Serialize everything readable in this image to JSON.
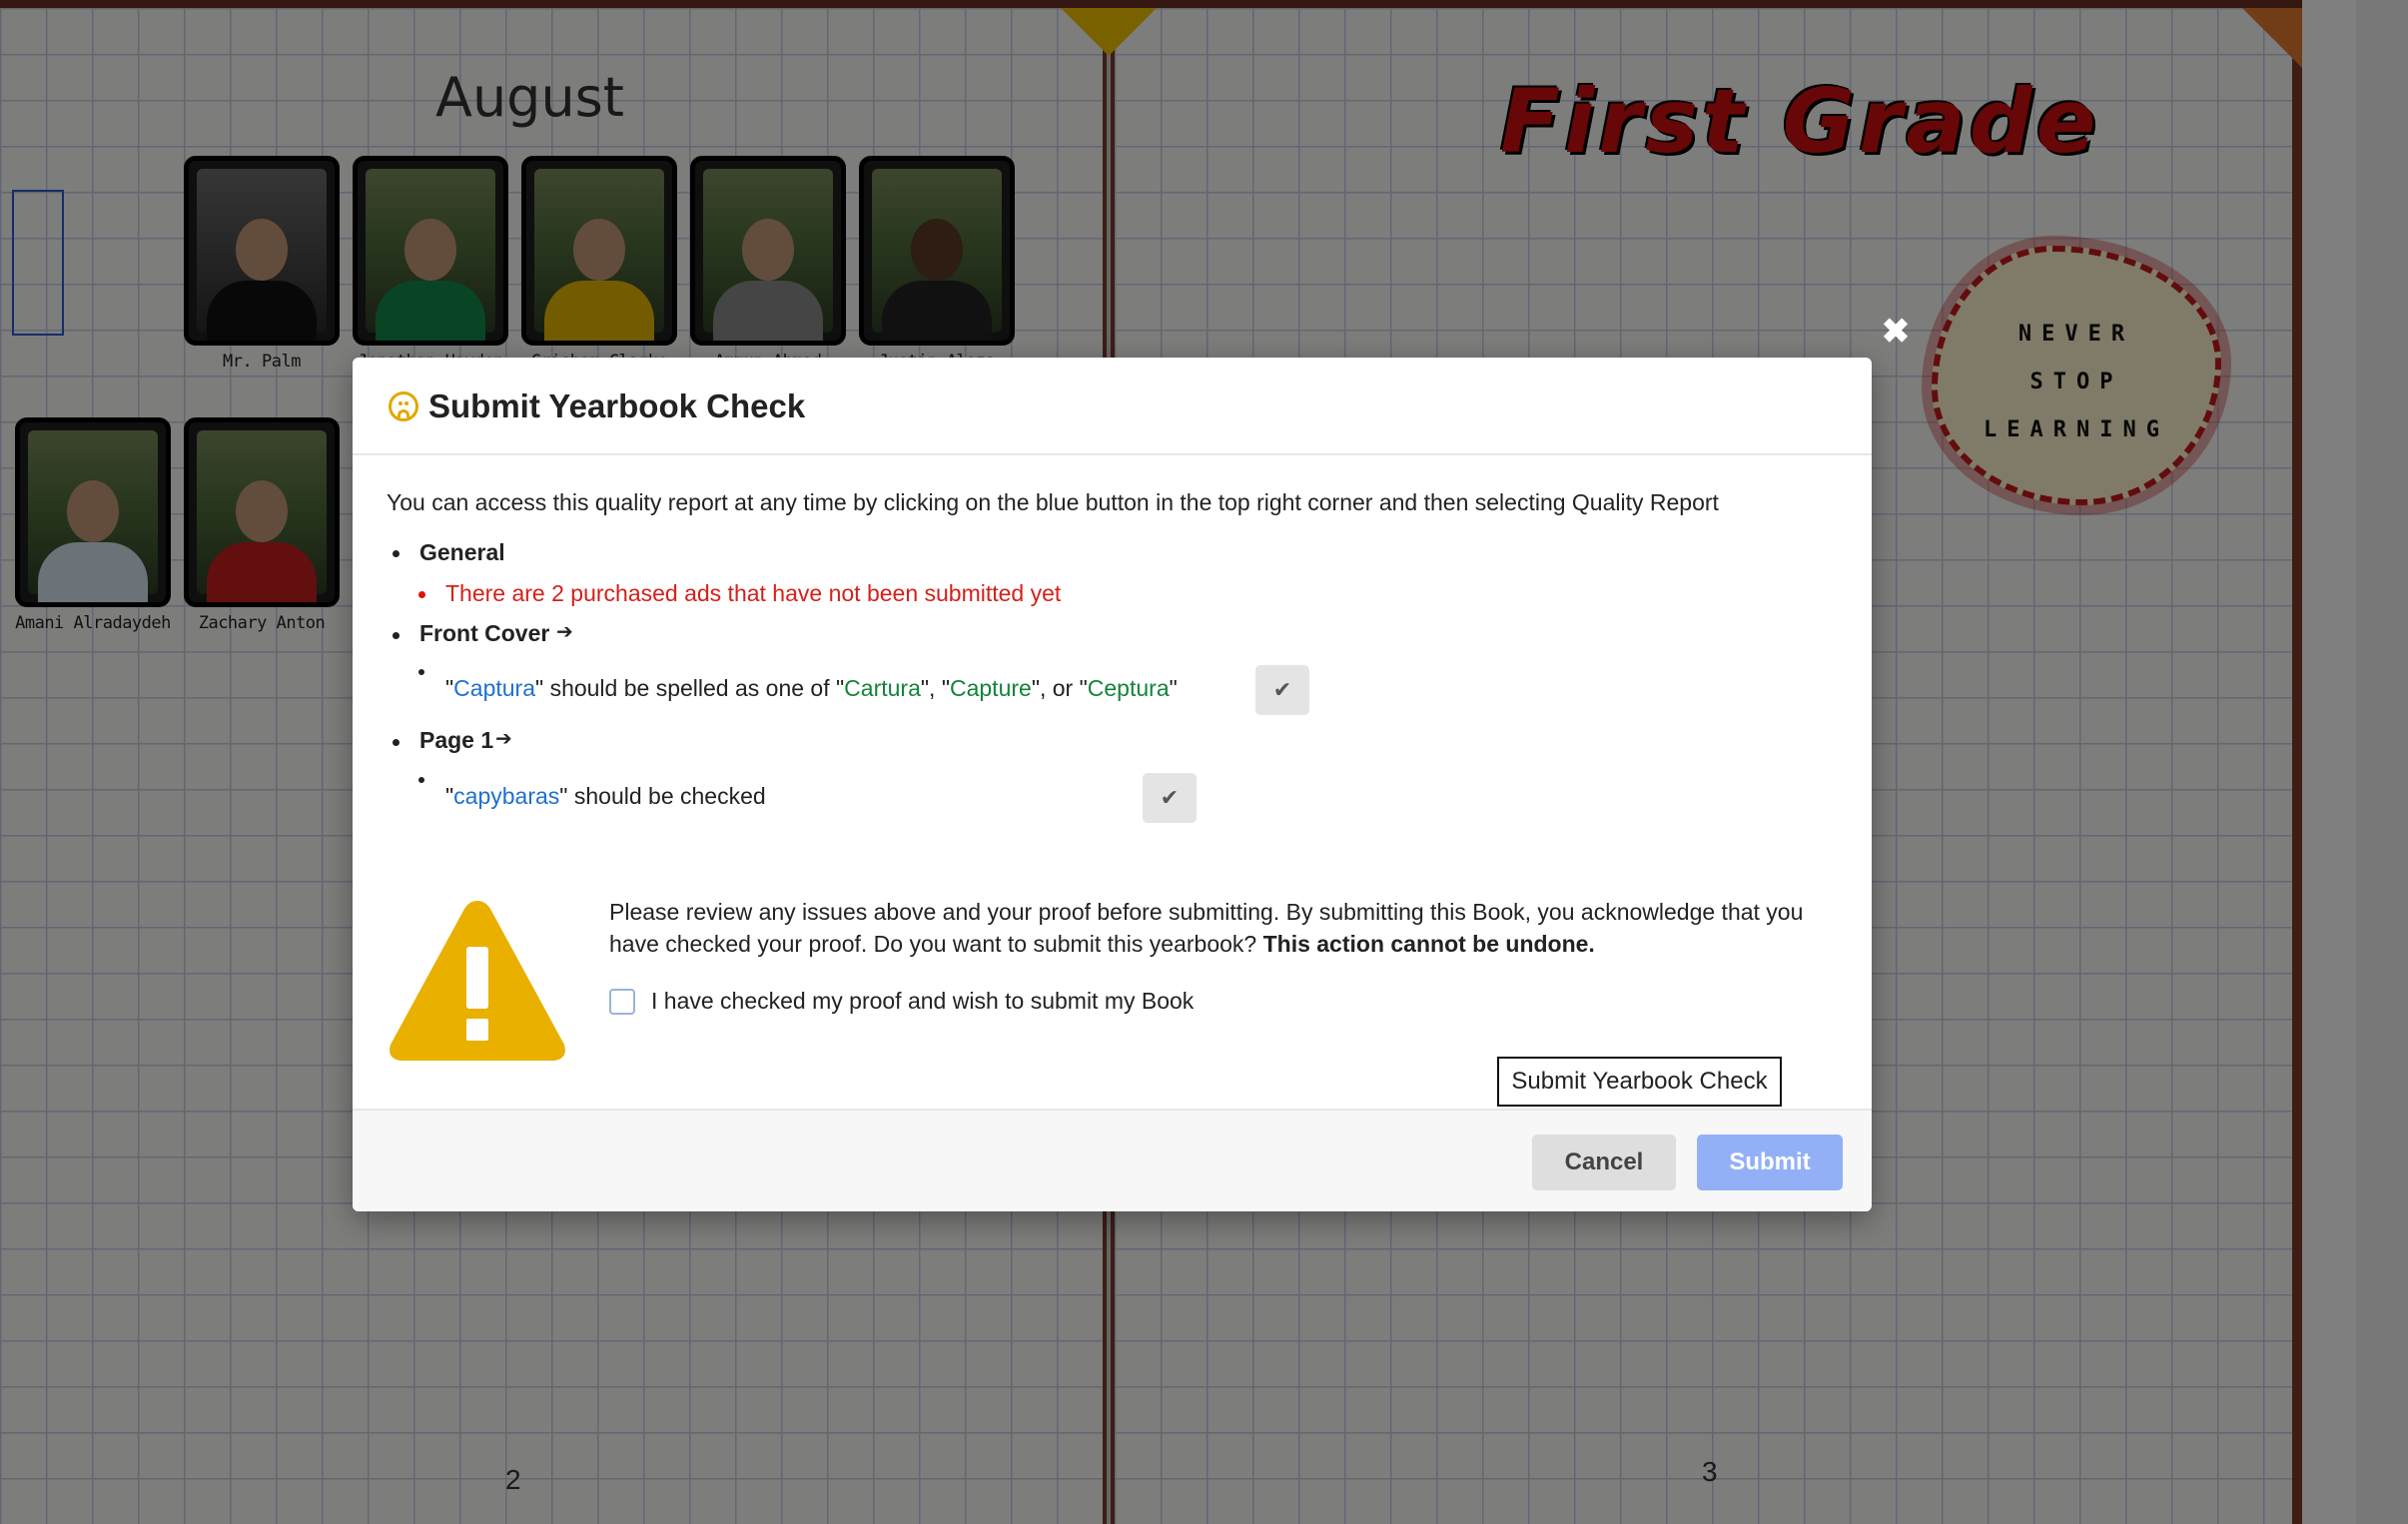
{
  "yearbook": {
    "left_page": {
      "month_title": "August",
      "page_number": "2",
      "portraits": [
        {
          "name": "Mr. Palm"
        },
        {
          "name": "Jonathan Hayden"
        },
        {
          "name": "Grisham Clarke"
        },
        {
          "name": "Ammun Ahmad"
        },
        {
          "name": "Justin Alaza"
        },
        {
          "name": "Amani Alradaydeh"
        },
        {
          "name": "Zachary Anton"
        }
      ]
    },
    "right_page": {
      "title": "First Grade",
      "badge_lines": [
        "NEVER",
        "STOP",
        "LEARNING"
      ],
      "page_number": "3"
    }
  },
  "modal": {
    "title": "Submit Yearbook Check",
    "intro": "You can access this quality report at any time by clicking on the blue button in the top right corner and then selecting Quality Report",
    "sections": {
      "general": {
        "label": "General",
        "issue": "There are 2 purchased ads that have not been submitted yet"
      },
      "front_cover": {
        "label": "Front Cover",
        "word": "Captura",
        "middle": "should be spelled as one of",
        "suggestions": [
          "Cartura",
          "Capture",
          "Ceptura"
        ],
        "or": "or"
      },
      "page_1": {
        "label": "Page 1",
        "word": "capybaras",
        "suffix": "should be checked"
      }
    },
    "warning_text": "Please review any issues above and your proof before submitting. By submitting this Book, you acknowledge that you have checked your proof. Do you want to submit this yearbook?",
    "warning_bold": "This action cannot be undone.",
    "checkbox_label": "I have checked my proof and wish to submit my Book",
    "tooltip": "Submit Yearbook Check",
    "cancel_label": "Cancel",
    "submit_label": "Submit"
  },
  "colors": {
    "warning_yellow": "#e9b000",
    "error_red": "#d6201a",
    "word_blue": "#1f6fd1",
    "suggestion_green": "#15833b",
    "submit_disabled": "#93b0f7"
  }
}
